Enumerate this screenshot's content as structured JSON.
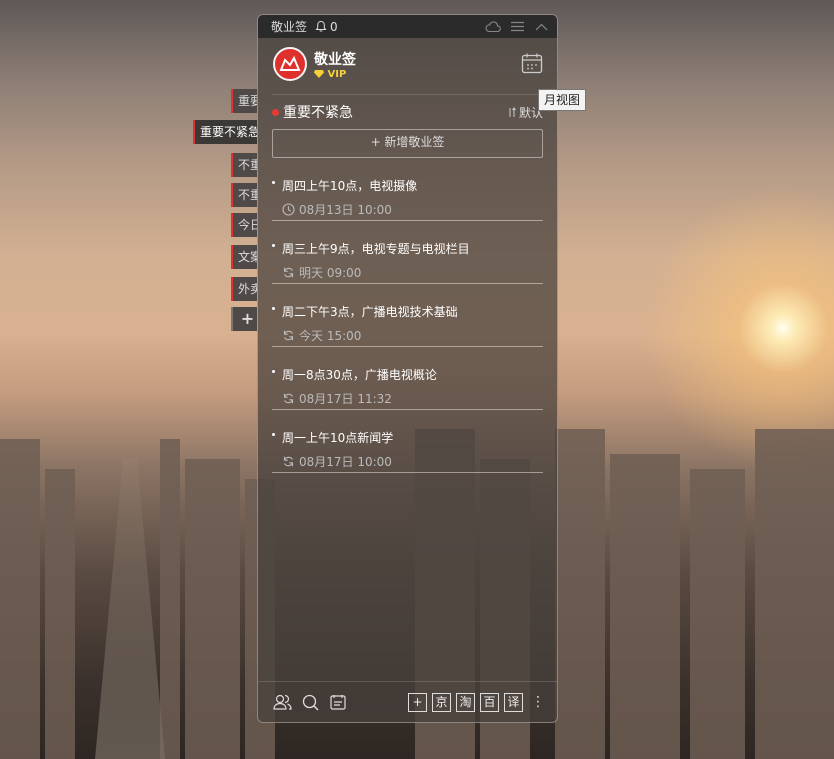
{
  "titlebar": {
    "title": "敬业签",
    "bell_count": "0"
  },
  "header": {
    "app_name": "敬业签",
    "vip_badge": "VIP"
  },
  "tooltip": "月视图",
  "side_tabs": [
    {
      "label": "重要",
      "active": false
    },
    {
      "label": "重要不紧急",
      "active": true
    },
    {
      "label": "不重",
      "active": false
    },
    {
      "label": "不重",
      "active": false
    },
    {
      "label": "今日",
      "active": false
    },
    {
      "label": "文案",
      "active": false
    },
    {
      "label": "外卖",
      "active": false
    },
    {
      "label": "+",
      "active": false
    }
  ],
  "group": {
    "title": "重要不紧急",
    "sort_label": "默认"
  },
  "add_button": "+ 新增敬业签",
  "notes": [
    {
      "title": "周四上午10点，电视摄像",
      "time": "08月13日 10:00",
      "icon": "clock-icon"
    },
    {
      "title": "周三上午9点，电视专题与电视栏目",
      "time": "明天 09:00",
      "icon": "repeat-icon"
    },
    {
      "title": "周二下午3点，广播电视技术基础",
      "time": "今天 15:00",
      "icon": "repeat-icon"
    },
    {
      "title": "周一8点30点，广播电视概论",
      "time": "08月17日 11:32",
      "icon": "repeat-icon"
    },
    {
      "title": "周一上午10点新闻学",
      "time": "08月17日 10:00",
      "icon": "repeat-icon"
    }
  ],
  "bottom_shortcuts": [
    "+",
    "京",
    "淘",
    "百",
    "译"
  ],
  "colors": {
    "accent_red": "#e53935",
    "vip_gold": "#f5d03a"
  }
}
